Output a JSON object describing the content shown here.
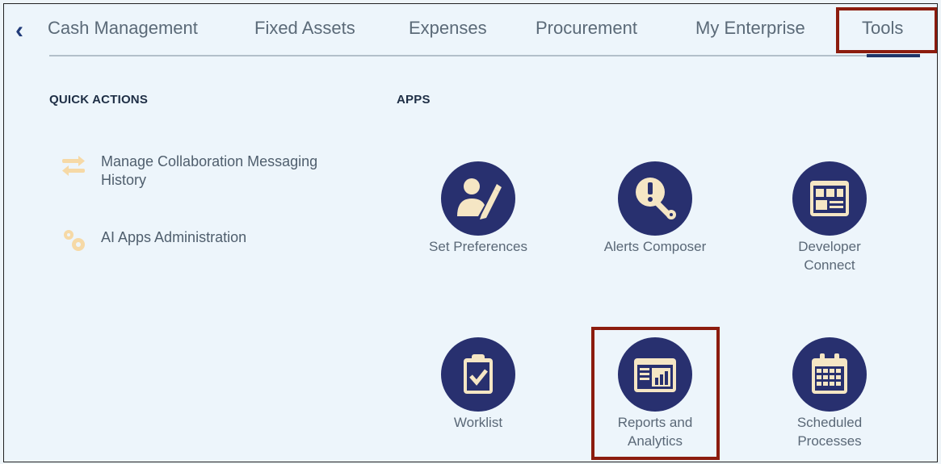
{
  "nav": {
    "tabs": [
      {
        "label": "Cash Management"
      },
      {
        "label": "Fixed Assets"
      },
      {
        "label": "Expenses"
      },
      {
        "label": "Procurement"
      },
      {
        "label": "My Enterprise"
      },
      {
        "label": "Tools",
        "active": true
      }
    ]
  },
  "quick_actions": {
    "title": "QUICK ACTIONS",
    "items": [
      {
        "label": "Manage Collaboration Messaging History",
        "icon": "collaboration-arrows-icon"
      },
      {
        "label": "AI Apps Administration",
        "icon": "gears-icon"
      }
    ]
  },
  "apps": {
    "title": "APPS",
    "items": [
      {
        "label": "Set Preferences",
        "icon": "user-pencil-icon"
      },
      {
        "label": "Alerts Composer",
        "icon": "alert-wrench-icon"
      },
      {
        "label": "Developer Connect",
        "icon": "developer-window-icon"
      },
      {
        "label": "Worklist",
        "icon": "clipboard-check-icon"
      },
      {
        "label": "Reports and Analytics",
        "icon": "report-chart-icon"
      },
      {
        "label": "Scheduled Processes",
        "icon": "calendar-icon"
      }
    ]
  },
  "colors": {
    "app_circle": "#28306f",
    "highlight_box": "#8c1c0e",
    "icon_fill": "#f5e6c4",
    "quick_action_icon": "#f6d9a6"
  }
}
